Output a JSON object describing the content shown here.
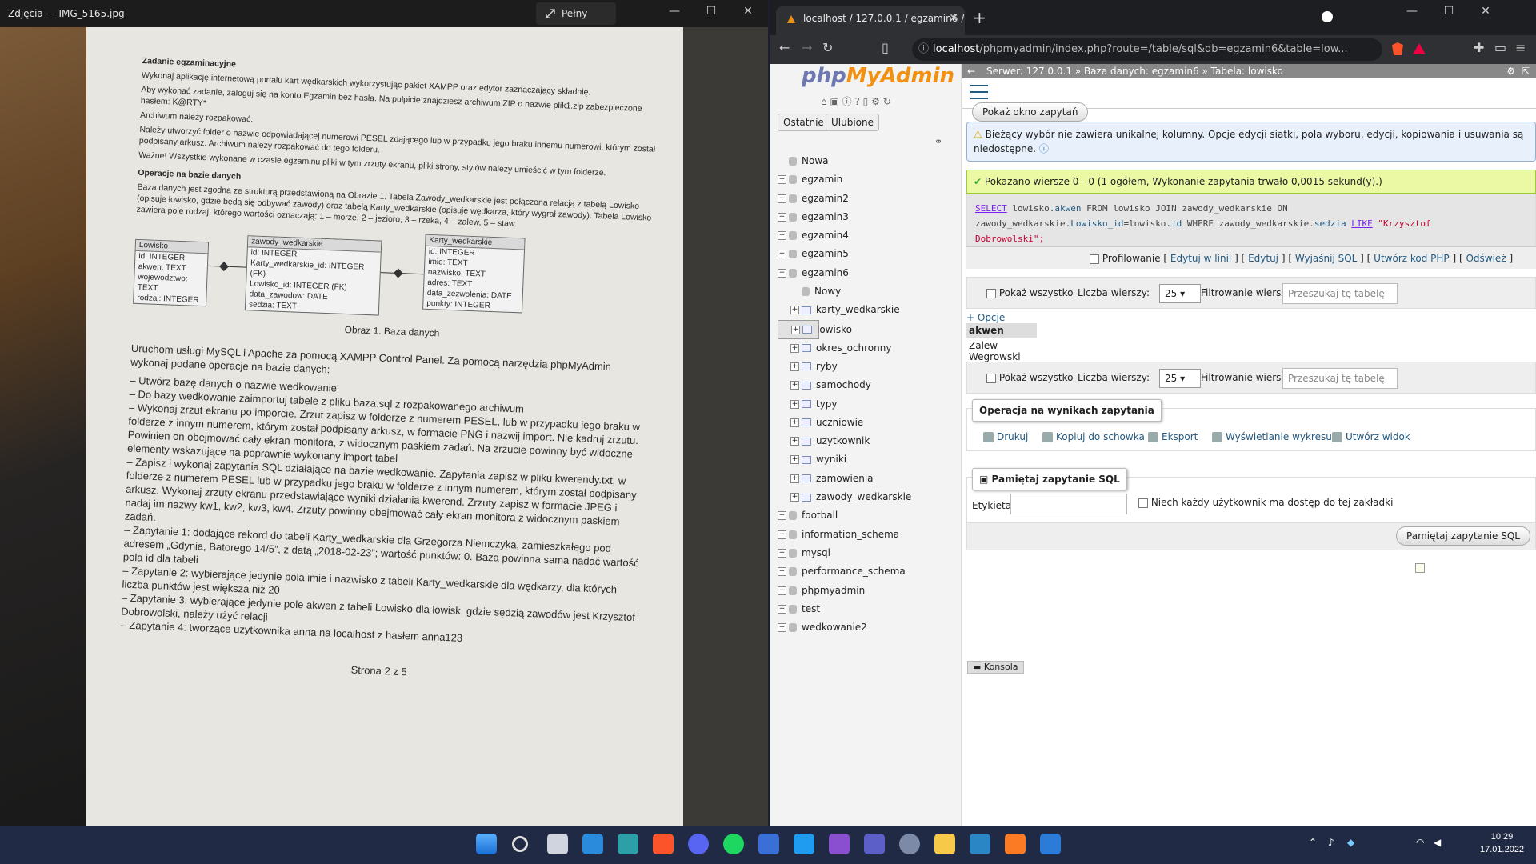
{
  "photos": {
    "title": "Zdjęcia — IMG_5165.jpg",
    "fullscreen_label": "Pełny ekran",
    "doc": {
      "p1_title": "Zadanie egzaminacyjne",
      "p1": "Wykonaj aplikację internetową portalu kart wędkarskich wykorzystując pakiet XAMPP oraz edytor zaznaczający składnię.",
      "p2": "Aby wykonać zadanie, zaloguj się na konto Egzamin bez hasła. Na pulpicie znajdziesz archiwum ZIP o nazwie plik1.zip zabezpieczone hasłem: K@RTY*",
      "p3": "Archiwum należy rozpakować.",
      "p4": "Należy utworzyć folder o nazwie odpowiadającej numerowi PESEL zdającego lub w przypadku jego braku innemu numerowi, którym został podpisany arkusz. Archiwum należy rozpakować do tego folderu.",
      "p5": "Ważne! Wszystkie wykonane w czasie egzaminu pliki w tym zrzuty ekranu, pliki strony, stylów należy umieścić w tym folderze.",
      "p6_title": "Operacje na bazie danych",
      "p6": "Baza danych jest zgodna ze strukturą przedstawioną na Obrazie 1. Tabela Zawody_wedkarskie jest połączona relacją z tabelą Lowisko (opisuje łowisko, gdzie będą się odbywać zawody) oraz tabelą Karty_wedkarskie (opisuje wędkarza, który wygrał zawody). Tabela Lowisko zawiera pole rodzaj, którego wartości oznaczają: 1 – morze, 2 – jezioro, 3 – rzeka, 4 – zalew, 5 – staw.",
      "entities": [
        {
          "name": "Lowisko",
          "rows": [
            "id: INTEGER",
            "akwen: TEXT",
            "wojewodztwo: TEXT",
            "rodzaj: INTEGER"
          ]
        },
        {
          "name": "zawody_wedkarskie",
          "rows": [
            "id: INTEGER",
            "Karty_wedkarskie_id: INTEGER (FK)",
            "Lowisko_id: INTEGER (FK)",
            "data_zawodow: DATE",
            "sedzia: TEXT"
          ]
        },
        {
          "name": "Karty_wedkarskie",
          "rows": [
            "id: INTEGER",
            "imie: TEXT",
            "nazwisko: TEXT",
            "adres: TEXT",
            "data_zezwolenia: DATE",
            "punkty: INTEGER"
          ]
        }
      ],
      "caption": "Obraz 1. Baza danych",
      "p7": "Uruchom usługi MySQL i Apache za pomocą XAMPP Control Panel. Za pomocą narzędzia phpMyAdmin wykonaj podane operacje na bazie danych:",
      "l1": "– Utwórz bazę danych o nazwie wedkowanie",
      "l2": "– Do bazy wedkowanie zaimportuj tabele z pliku baza.sql z rozpakowanego archiwum",
      "l3": "– Wykonaj zrzut ekranu po imporcie. Zrzut zapisz w folderze z numerem PESEL, lub w przypadku jego braku w folderze z innym numerem, którym został podpisany arkusz, w formacie PNG i nazwij import. Nie kadruj zrzutu. Powinien on obejmować cały ekran monitora, z widocznym paskiem zadań. Na zrzucie powinny być widoczne elementy wskazujące na poprawnie wykonany import tabel",
      "l4": "– Zapisz i wykonaj zapytania SQL działające na bazie wedkowanie. Zapytania zapisz w pliku kwerendy.txt, w folderze z numerem PESEL lub w przypadku jego braku w folderze z innym numerem, którym został podpisany arkusz. Wykonaj zrzuty ekranu przedstawiające wyniki działania kwerend. Zrzuty zapisz w formacie JPEG i nadaj im nazwy kw1, kw2, kw3, kw4. Zrzuty powinny obejmować cały ekran monitora z widocznym paskiem zadań.",
      "l5": "– Zapytanie 1: dodające rekord do tabeli Karty_wedkarskie dla Grzegorza Niemczyka, zamieszkałego pod adresem „Gdynia, Batorego 14/5”, z datą „2018-02-23”; wartość punktów: 0. Baza powinna sama nadać wartość pola id dla tabeli",
      "l6": "– Zapytanie 2: wybierające jedynie pola imie i nazwisko z tabeli Karty_wedkarskie dla wędkarzy, dla których liczba punktów jest większa niż 20",
      "l7": "– Zapytanie 3: wybierające jedynie pole akwen z tabeli Lowisko dla łowisk, gdzie sędzią zawodów jest Krzysztof Dobrowolski, należy użyć relacji",
      "l8": "– Zapytanie 4: tworzące użytkownika anna na localhost z hasłem anna123",
      "page": "Strona 2 z 5"
    }
  },
  "browser": {
    "tab_title": "localhost / 127.0.0.1 / egzamin6 /",
    "url_host": "localhost",
    "url_rest": "/phpmyadmin/index.php?route=/table/sql&db=egzamin6&table=low..."
  },
  "pma": {
    "tabs": [
      "Ostatnie",
      "Ulubione"
    ],
    "tree": [
      {
        "label": "Nowa",
        "type": "new"
      },
      {
        "label": "egzamin",
        "type": "db"
      },
      {
        "label": "egzamin2",
        "type": "db"
      },
      {
        "label": "egzamin3",
        "type": "db"
      },
      {
        "label": "egzamin4",
        "type": "db"
      },
      {
        "label": "egzamin5",
        "type": "db"
      },
      {
        "label": "egzamin6",
        "type": "db-open"
      },
      {
        "label": "Nowy",
        "type": "new-sub"
      },
      {
        "label": "karty_wedkarskie",
        "type": "table"
      },
      {
        "label": "lowisko",
        "type": "table-sel"
      },
      {
        "label": "okres_ochronny",
        "type": "table"
      },
      {
        "label": "ryby",
        "type": "table"
      },
      {
        "label": "samochody",
        "type": "table"
      },
      {
        "label": "typy",
        "type": "table"
      },
      {
        "label": "uczniowie",
        "type": "table"
      },
      {
        "label": "uzytkownik",
        "type": "table"
      },
      {
        "label": "wyniki",
        "type": "table"
      },
      {
        "label": "zamowienia",
        "type": "table"
      },
      {
        "label": "zawody_wedkarskie",
        "type": "table"
      },
      {
        "label": "football",
        "type": "db"
      },
      {
        "label": "information_schema",
        "type": "db"
      },
      {
        "label": "mysql",
        "type": "db"
      },
      {
        "label": "performance_schema",
        "type": "db"
      },
      {
        "label": "phpmyadmin",
        "type": "db"
      },
      {
        "label": "test",
        "type": "db"
      },
      {
        "label": "wedkowanie2",
        "type": "db"
      }
    ],
    "breadcrumb": {
      "server": "Serwer: 127.0.0.1",
      "db": "Baza danych: egzamin6",
      "table": "Tabela: lowisko"
    },
    "show_query_btn": "Pokaż okno zapytań",
    "notice": "Bieżący wybór nie zawiera unikalnej kolumny. Opcje edycji siatki, pola wyboru, edycji, kopiowania i usuwania są niedostępne.",
    "success": "Pokazano wiersze 0 - 0 (1 ogółem, Wykonanie zapytania trwało 0,0015 sekund(y).)",
    "sql": {
      "line1a": "SELECT",
      "line1b": " lowisko.",
      "line1c": "akwen",
      "line1d": " FROM lowisko JOIN zawody_wedkarskie ON",
      "line2a": "zawody_wedkarskie.",
      "line2b": "Lowisko_id",
      "line2c": "=lowisko.",
      "line2d": "id",
      "line2e": " WHERE zawody_wedkarskie.",
      "line2f": "sedzia",
      "line2g": " ",
      "line2h": "LIKE",
      "line2i": " \"Krzysztof",
      "line3": "Dobrowolski\";"
    },
    "profiling": "Profilowanie",
    "links": [
      "Edytuj w linii",
      "Edytuj",
      "Wyjaśnij SQL",
      "Utwórz kod PHP",
      "Odśwież"
    ],
    "show_all": "Pokaż wszystko",
    "rows_label": "Liczba wierszy:",
    "rows_value": "25",
    "filter_label": "Filtrowanie wierszy:",
    "filter_placeholder": "Przeszukaj tę tabelę",
    "options": "+ Opcje",
    "col_header": "akwen",
    "cell": "Zalew Wegrowski",
    "ops_legend": "Operacja na wynikach zapytania",
    "ops": [
      "Drukuj",
      "Kopiuj do schowka",
      "Eksport",
      "Wyświetlanie wykresu",
      "Utwórz widok"
    ],
    "bm_legend": "Pamiętaj zapytanie SQL",
    "bm_label": "Etykieta:",
    "bm_check": "Niech każdy użytkownik ma dostęp do tej zakładki",
    "bm_btn": "Pamiętaj zapytanie SQL",
    "console": "Konsola"
  },
  "taskbar": {
    "time": "10:29",
    "date": "17.01.2022"
  }
}
